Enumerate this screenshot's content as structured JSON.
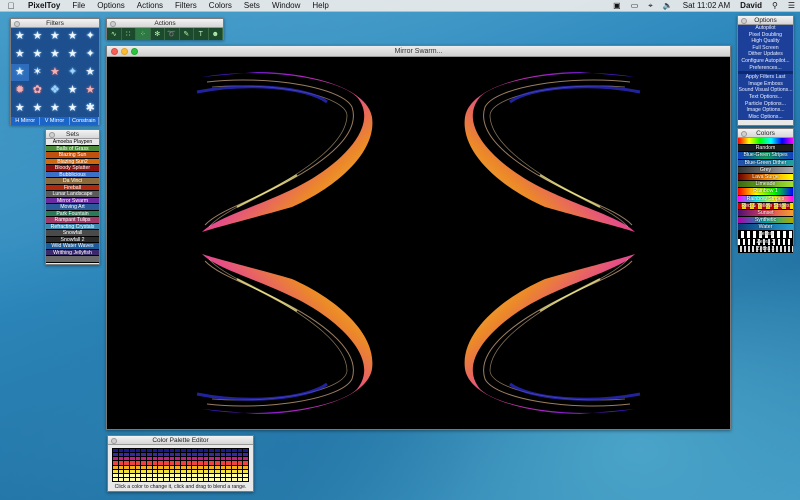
{
  "menubar": {
    "app_name": "PixelToy",
    "items": [
      "File",
      "Options",
      "Actions",
      "Filters",
      "Colors",
      "Sets",
      "Window",
      "Help"
    ],
    "clock": "Sat 11:02 AM",
    "user": "David"
  },
  "filters": {
    "title": "Filters",
    "icons": [
      "star-icon",
      "star-icon",
      "star-icon",
      "star-icon",
      "star-icon",
      "star-icon",
      "star-icon",
      "star-icon",
      "star-icon",
      "star-icon",
      "star-icon",
      "star-icon",
      "star-icon",
      "star-icon",
      "star-icon",
      "star-icon",
      "star-icon",
      "star-icon",
      "star-icon",
      "star-icon",
      "star-icon",
      "star-icon",
      "star-icon",
      "star-icon",
      "star-icon"
    ],
    "mirror_buttons": [
      "H Mirror",
      "V Mirror",
      "Constrain"
    ]
  },
  "actions": {
    "title": "Actions",
    "icons": [
      "wave-icon",
      "dots-icon",
      "scatter-icon",
      "particle-icon",
      "swirl-icon",
      "brush-icon",
      "text-icon",
      "image-icon"
    ]
  },
  "sets": {
    "title": "Sets",
    "items": [
      {
        "label": "Amoeba Playpen",
        "bg": "#e8e8e8",
        "fg": "#000"
      },
      {
        "label": "Balls of Grass",
        "bg": "#4a8c3a",
        "fg": "#fff"
      },
      {
        "label": "Blazing Sun",
        "bg": "#c05010",
        "fg": "#fff"
      },
      {
        "label": "Blazing Sun2",
        "bg": "#d06a10",
        "fg": "#fff"
      },
      {
        "label": "Bloody Splatter",
        "bg": "#8a1010",
        "fg": "#fff"
      },
      {
        "label": "Bubblicious",
        "bg": "#3a70c8",
        "fg": "#fff"
      },
      {
        "label": "Da Vinci",
        "bg": "#8a6a3a",
        "fg": "#fff"
      },
      {
        "label": "Fireball",
        "bg": "#b02a10",
        "fg": "#fff"
      },
      {
        "label": "Lunar Landscape",
        "bg": "#5a5a5a",
        "fg": "#fff"
      },
      {
        "label": "Mirror Swarm",
        "bg": "#6a2aa0",
        "fg": "#fff"
      },
      {
        "label": "Moving Art",
        "bg": "#2a5a9a",
        "fg": "#fff"
      },
      {
        "label": "Park Fountain",
        "bg": "#2a7a5a",
        "fg": "#fff"
      },
      {
        "label": "Rampant Tulips",
        "bg": "#a03a6a",
        "fg": "#fff"
      },
      {
        "label": "Refracting Crystals",
        "bg": "#3a8ab0",
        "fg": "#fff"
      },
      {
        "label": "Snowfall",
        "bg": "#4a4a4a",
        "fg": "#fff"
      },
      {
        "label": "Snowfall 2",
        "bg": "#2a2a2a",
        "fg": "#fff"
      },
      {
        "label": "Wild Water Waves",
        "bg": "#1a5a9a",
        "fg": "#fff"
      },
      {
        "label": "Writhing Jellyfish",
        "bg": "#3a2a6a",
        "fg": "#fff"
      },
      {
        "label": "",
        "bg": "#6a6a6a",
        "fg": "#fff"
      }
    ]
  },
  "main_window": {
    "title": "Mirror Swarm..."
  },
  "options": {
    "title": "Options",
    "group1": [
      "Autopilot",
      "Pixel Doubling",
      "High Quality",
      "Full Screen",
      "Dither Updates",
      "Configure Autopilot...",
      "Preferences..."
    ],
    "group2": [
      "Apply Filters Last",
      "Image Emboss",
      "Sound Visual Options...",
      "Text Options...",
      "Particle Options...",
      "Image Options...",
      "Misc Options..."
    ]
  },
  "colors": {
    "title": "Colors",
    "items": [
      {
        "label": "",
        "bg": "linear-gradient(90deg,#f00,#ff0,#0f0,#0ff,#00f,#f0f)"
      },
      {
        "label": "Random",
        "bg": "#1a1a1a"
      },
      {
        "label": "Blue-Green Stripes",
        "bg": "linear-gradient(90deg,#1040c0,#10a060,#1040c0)"
      },
      {
        "label": "Blue-Green Dither",
        "bg": "linear-gradient(90deg,#2050b0,#20a0a0)"
      },
      {
        "label": "Grey",
        "bg": "linear-gradient(90deg,#333,#aaa)"
      },
      {
        "label": "Lava Surge",
        "bg": "linear-gradient(90deg,#600,#f80,#ff0)"
      },
      {
        "label": "Limeade",
        "bg": "linear-gradient(90deg,#3a6a10,#a0e030)"
      },
      {
        "label": "Rainbow 1",
        "bg": "linear-gradient(90deg,#f00,#ff0,#0f0,#00f)"
      },
      {
        "label": "Rainbow Stripes",
        "bg": "linear-gradient(90deg,#f0f,#0ff,#ff0,#f0f)"
      },
      {
        "label": "Red & Yellow Stripes",
        "bg": "repeating-linear-gradient(90deg,#c00 0 4px,#fd0 4px 8px)"
      },
      {
        "label": "Sunset",
        "bg": "linear-gradient(90deg,#4a1070,#e04060,#f0a030)"
      },
      {
        "label": "Synthetic",
        "bg": "linear-gradient(90deg,#a0a,#0aa,#aa0)"
      },
      {
        "label": "Water",
        "bg": "linear-gradient(90deg,#0a3a7a,#2aa0d0)"
      },
      {
        "label": "Zebra",
        "bg": "repeating-linear-gradient(90deg,#000 0 3px,#fff 3px 6px)"
      },
      {
        "label": "Zebra 2",
        "bg": "repeating-linear-gradient(90deg,#fff 0 2px,#000 2px 5px)"
      },
      {
        "label": "Zebra 3",
        "bg": "repeating-linear-gradient(90deg,#000 0 2px,#ddd 2px 4px)"
      }
    ]
  },
  "palette_editor": {
    "title": "Color Palette Editor",
    "help": "Click a color to change it, click and drag to blend a range.",
    "rows": [
      "#000000",
      "#0a0a3a",
      "#1a1a8a",
      "#3a2aa0",
      "#7a20a0",
      "#c02080",
      "#f04040",
      "#f07a20",
      "#f0b020",
      "#f0e040",
      "#fff070",
      "#ffffa0"
    ]
  }
}
